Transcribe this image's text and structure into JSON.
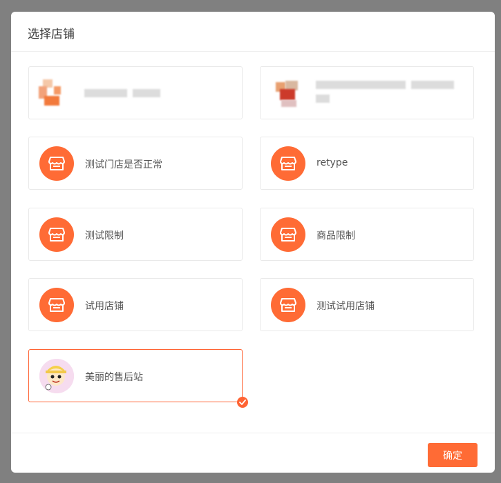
{
  "dialog": {
    "title": "选择店铺",
    "confirm_label": "确定"
  },
  "accent_color": "#ff6b35",
  "stores": [
    {
      "label": "",
      "icon": "blurred-logo",
      "selected": false
    },
    {
      "label": "",
      "icon": "blurred-logo",
      "selected": false
    },
    {
      "label": "测试门店是否正常",
      "icon": "store-icon",
      "selected": false
    },
    {
      "label": "retype",
      "icon": "store-icon",
      "selected": false
    },
    {
      "label": "测试限制",
      "icon": "store-icon",
      "selected": false
    },
    {
      "label": "商品限制",
      "icon": "store-icon",
      "selected": false
    },
    {
      "label": "试用店铺",
      "icon": "store-icon",
      "selected": false
    },
    {
      "label": "测试试用店铺",
      "icon": "store-icon",
      "selected": false
    },
    {
      "label": "美丽的售后站",
      "icon": "cartoon-avatar",
      "selected": true
    }
  ]
}
